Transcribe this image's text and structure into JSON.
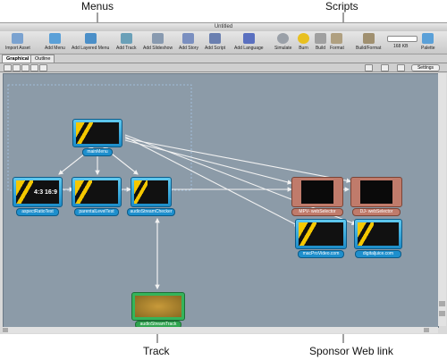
{
  "callouts": {
    "menus": "Menus",
    "scripts": "Scripts",
    "track": "Track",
    "sponsor": "Sponsor Web link"
  },
  "window": {
    "title": "Untitled"
  },
  "toolbar": {
    "import_asset": "Import Asset",
    "add_menu": "Add Menu",
    "add_layered_menu": "Add Layered Menu",
    "add_track": "Add Track",
    "add_slideshow": "Add Slideshow",
    "add_story": "Add Story",
    "add_script": "Add Script",
    "add_language": "Add Language",
    "simulate": "Simulate",
    "burn": "Burn",
    "build": "Build",
    "format": "Format",
    "build_format": "Build/Format",
    "capacity": "168 KB",
    "palette": "Palette"
  },
  "tabs": [
    "Graphical",
    "Outline"
  ],
  "settings_label": "Settings",
  "nodes": {
    "main_menu": "mainMenu",
    "aspect_ratio_test": "aspectRatioTest",
    "parental_level_test": "parentalLevelTest",
    "audio_stream_checker": "audioStreamChecker",
    "mpv_web_selector": "MPV- webSelector",
    "dj_web_selector": "DJ- webSelector",
    "mac_pro_video": "macProVideo.com",
    "digital_juice": "digitaljuice.com",
    "audio_stream_track": "audioStreamTrack"
  },
  "badges": {
    "ratio_43": "4:3",
    "ratio_169": "16:9"
  },
  "colors": {
    "canvas": "#8c9ba8",
    "menu_node": "#1e8fcd",
    "script_node": "#c07b6b",
    "track_node": "#2fa44f",
    "connector": "#f2f2f2"
  }
}
